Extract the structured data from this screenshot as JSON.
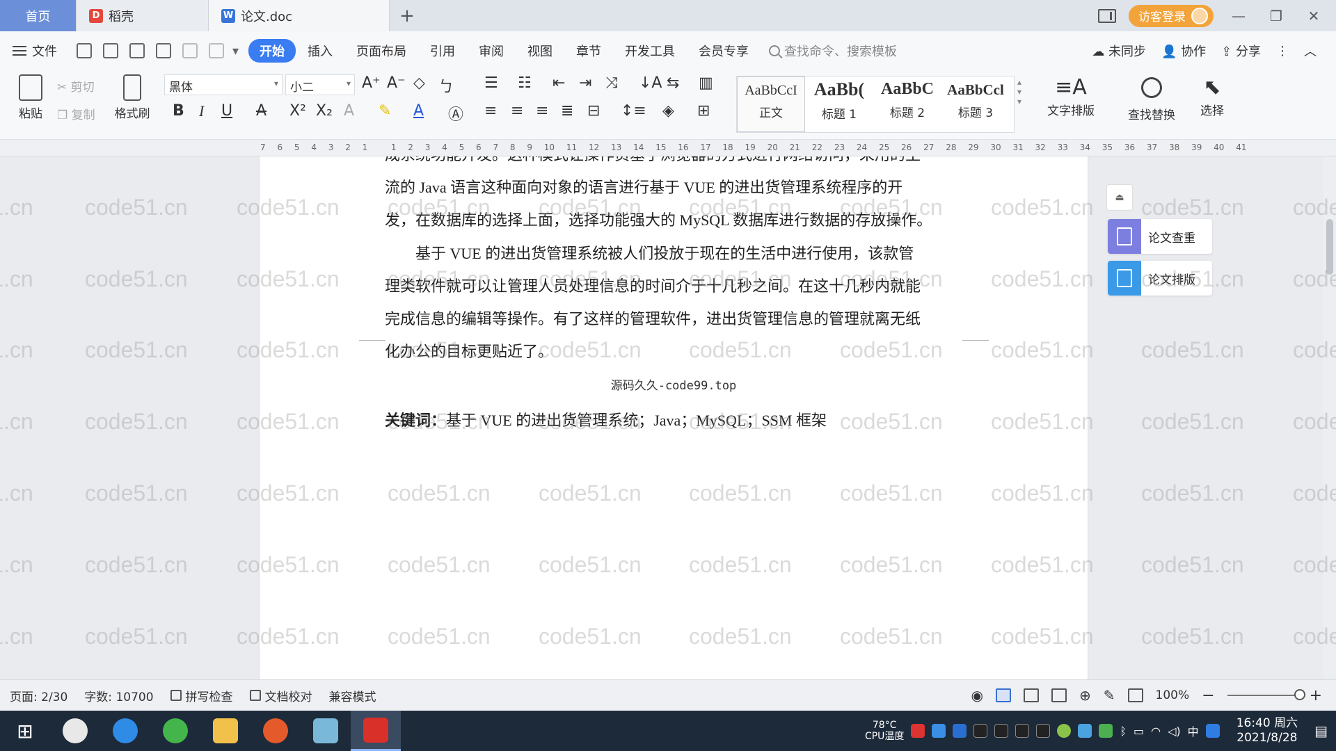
{
  "titlebar": {
    "tabs": [
      {
        "label": "首页"
      },
      {
        "label": "稻壳"
      },
      {
        "label": "论文.doc"
      }
    ],
    "visitor_login": "访客登录"
  },
  "menubar": {
    "file": "文件",
    "items": [
      "开始",
      "插入",
      "页面布局",
      "引用",
      "审阅",
      "视图",
      "章节",
      "开发工具",
      "会员专享"
    ],
    "search_placeholder": "查找命令、搜索模板",
    "unsynced": "未同步",
    "collab": "协作",
    "share": "分享"
  },
  "ribbon": {
    "paste": "粘贴",
    "cut": "剪切",
    "copy": "复制",
    "format_painter": "格式刷",
    "font_name": "黑体",
    "font_size": "小二",
    "styles": [
      {
        "sample": "AaBbCcI",
        "name": "正文"
      },
      {
        "sample": "AaBb(",
        "name": "标题 1"
      },
      {
        "sample": "AaBbC",
        "name": "标题 2"
      },
      {
        "sample": "AaBbCcl",
        "name": "标题 3"
      }
    ],
    "text_layout": "文字排版",
    "find_replace": "查找替换",
    "select": "选择"
  },
  "ruler": {
    "ticks": [
      "7",
      "6",
      "5",
      "4",
      "3",
      "2",
      "1",
      "",
      "1",
      "2",
      "3",
      "4",
      "5",
      "6",
      "7",
      "8",
      "9",
      "10",
      "11",
      "12",
      "13",
      "14",
      "15",
      "16",
      "17",
      "18",
      "19",
      "20",
      "21",
      "22",
      "23",
      "24",
      "25",
      "26",
      "27",
      "28",
      "29",
      "30",
      "31",
      "32",
      "33",
      "34",
      "35",
      "36",
      "37",
      "38",
      "39",
      "40",
      "41"
    ]
  },
  "document": {
    "para1_line0": "成系统功能开发。这种模式让操作员基于浏览器的方式进行网络访问，采用的主",
    "para1_line1": "流的 Java 语言这种面向对象的语言进行基于 VUE 的进出货管理系统程序的开",
    "para1_line2": "发，在数据库的选择上面，选择功能强大的 MySQL 数据库进行数据的存放操作。",
    "para2_line1": "基于 VUE 的进出货管理系统被人们投放于现在的生活中进行使用，该款管",
    "para2_line2": "理类软件就可以让管理人员处理信息的时间介于十几秒之间。在这十几秒内就能",
    "para2_line3": "完成信息的编辑等操作。有了这样的管理软件，进出货管理信息的管理就离无纸",
    "para2_line4": "化办公的目标更贴近了。",
    "source_note": "源码久久-code99.top",
    "keywords_label": "关键词：",
    "keywords_text": "基于 VUE 的进出货管理系统；Java；MySQL；SSM 框架"
  },
  "side_panel": {
    "check": "论文查重",
    "format": "论文排版"
  },
  "watermark": "code51.cn",
  "statusbar": {
    "page": "页面: 2/30",
    "words": "字数: 10700",
    "spell": "拼写检查",
    "proof": "文档校对",
    "compat": "兼容模式",
    "zoom": "100%"
  },
  "taskbar": {
    "cpu_temp": "78°C",
    "cpu_label": "CPU温度",
    "ime": "中",
    "time": "16:40 周六",
    "date": "2021/8/28"
  },
  "colors": {
    "accent": "#3a7cf2",
    "home_tab": "#6b8fd8",
    "visitor": "#f2a33a",
    "taskbar": "#1d2a3a"
  }
}
